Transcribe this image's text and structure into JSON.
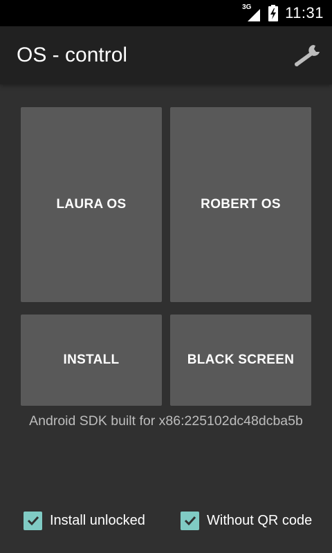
{
  "status_bar": {
    "network": "3G",
    "time": "11:31",
    "icons": [
      "signal-icon",
      "battery-charging-icon"
    ]
  },
  "app_bar": {
    "title": "OS - control",
    "action_icon": "wrench-icon"
  },
  "buttons": {
    "laura_os": "LAURA OS",
    "robert_os": "ROBERT OS",
    "install": "INSTALL",
    "black_screen": "BLACK SCREEN"
  },
  "device_id": "Android SDK built for x86:225102dc48dcba5b",
  "options": {
    "install_unlocked": {
      "label": "Install unlocked",
      "checked": true
    },
    "without_qr": {
      "label": "Without QR code",
      "checked": true
    }
  },
  "colors": {
    "background": "#303030",
    "app_bar": "#212121",
    "button": "#595959",
    "checkbox_accent": "#80cbc4"
  }
}
